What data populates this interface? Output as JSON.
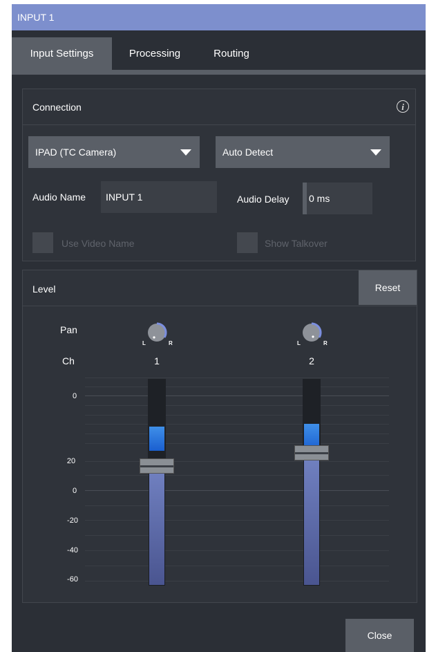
{
  "window": {
    "title": "INPUT 1"
  },
  "tabs": [
    {
      "label": "Input Settings",
      "active": true
    },
    {
      "label": "Processing",
      "active": false
    },
    {
      "label": "Routing",
      "active": false
    }
  ],
  "connection": {
    "title": "Connection",
    "info_icon": "info-icon",
    "source_dropdown": "IPAD (TC Camera)",
    "format_dropdown": "Auto Detect",
    "audio_name_label": "Audio Name",
    "audio_name_value": "INPUT 1",
    "audio_delay_label": "Audio Delay",
    "audio_delay_value": "0 ms",
    "use_video_name_label": "Use Video Name",
    "show_talkover_label": "Show Talkover"
  },
  "level": {
    "title": "Level",
    "reset_label": "Reset",
    "pan_label": "Pan",
    "ch_label": "Ch",
    "knob_left": "L",
    "knob_right": "R",
    "channels": [
      {
        "number": "1",
        "meter_level": 0.33,
        "fader_level": 0.85
      },
      {
        "number": "2",
        "meter_level": 0.37,
        "fader_level": 0.94
      }
    ],
    "meter_scale": [
      "0"
    ],
    "fader_scale": [
      "20",
      "0",
      "-20",
      "-40",
      "-60"
    ]
  },
  "footer": {
    "close_label": "Close"
  },
  "colors": {
    "title_bar": "#7d8fcd",
    "background": "#2b2f36",
    "meter": "#2f7fe0",
    "fader": "#6675b5"
  }
}
